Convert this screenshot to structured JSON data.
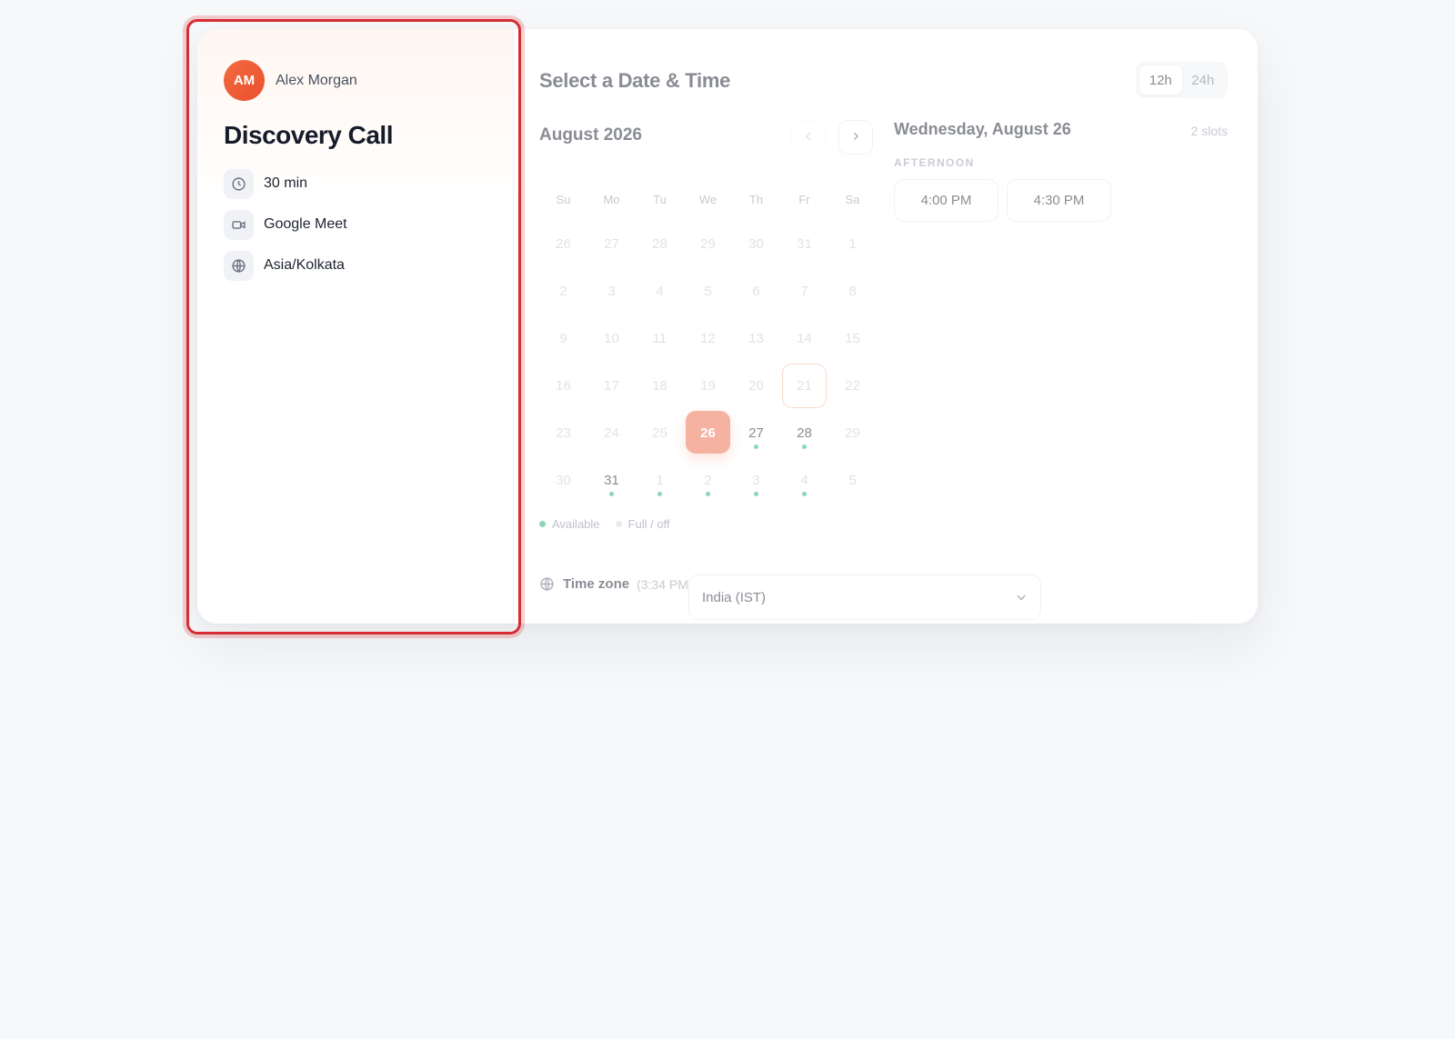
{
  "host": {
    "initials": "AM",
    "name": "Alex Morgan"
  },
  "event": {
    "title": "Discovery Call",
    "duration": "30 min",
    "location": "Google Meet",
    "timezone": "Asia/Kolkata"
  },
  "booking": {
    "title": "Select a Date & Time",
    "time_format": {
      "options": [
        "12h",
        "24h"
      ],
      "selected": "12h"
    },
    "calendar": {
      "month_label": "August 2026",
      "weekdays": [
        "Su",
        "Mo",
        "Tu",
        "We",
        "Th",
        "Fr",
        "Sa"
      ],
      "weeks": [
        [
          "26",
          "27",
          "28",
          "29",
          "30",
          "31",
          "1"
        ],
        [
          "2",
          "3",
          "4",
          "5",
          "6",
          "7",
          "8"
        ],
        [
          "9",
          "10",
          "11",
          "12",
          "13",
          "14",
          "15"
        ],
        [
          "16",
          "17",
          "18",
          "19",
          "20",
          "21",
          "22"
        ],
        [
          "23",
          "24",
          "25",
          "26",
          "27",
          "28",
          "29"
        ],
        [
          "30",
          "31",
          "1",
          "2",
          "3",
          "4",
          "5"
        ]
      ],
      "legend": {
        "available": "Available",
        "unavailable": "Full / off"
      }
    },
    "timezone": {
      "label": "Time zone",
      "current_time": "(3:34 PM)",
      "selected": "India (IST)"
    },
    "slots_panel": {
      "date_heading": "Wednesday, August 26",
      "slot_count": "2 slots",
      "period": "AFTERNOON",
      "slots": [
        "4:00 PM",
        "4:30 PM"
      ]
    }
  },
  "colors": {
    "accent": "#ee7456",
    "available_dot": "#2eb67d",
    "focus_outline": "#d62c34"
  }
}
